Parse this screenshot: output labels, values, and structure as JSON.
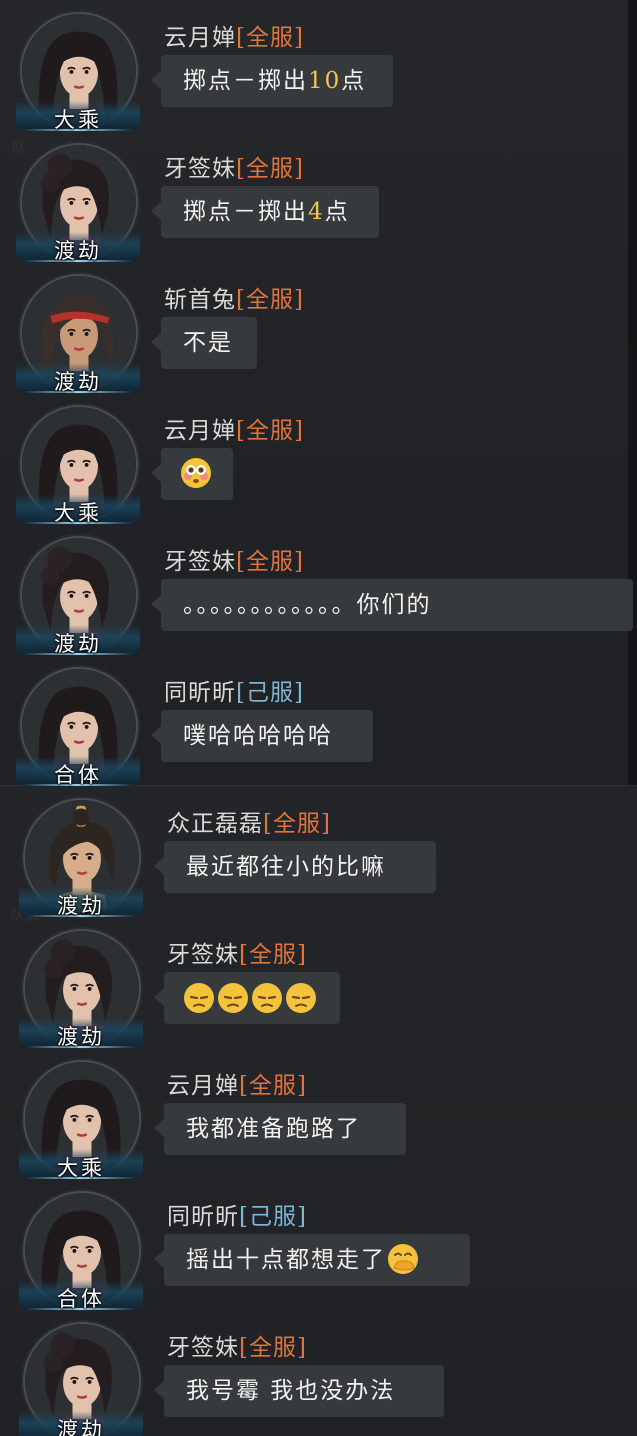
{
  "colors": {
    "background": "#1c1e20",
    "bubble": "#373a3c",
    "tag_server": "#e0743c",
    "tag_own_server": "#7fb4d6",
    "highlight_number": "#f2c94c",
    "text": "#f2f2f0",
    "name": "#d9d9d6"
  },
  "background_text": [
    "队",
    "队伍"
  ],
  "messages": [
    {
      "avatar": "female-dark-hair-avatar",
      "rank": "大乘",
      "name": "云月婵",
      "tag": "[全服]",
      "text_prefix": "掷点－掷出",
      "text_number": "10",
      "text_suffix": "点"
    },
    {
      "avatar": "female-bun-hair-avatar",
      "rank": "渡劫",
      "name": "牙签妹",
      "tag": "[全服]",
      "text_prefix": "掷点－掷出",
      "text_number": "4",
      "text_suffix": "点"
    },
    {
      "avatar": "male-headband-avatar",
      "rank": "渡劫",
      "name": "斩首兔",
      "tag": "[全服]",
      "text": "不是"
    },
    {
      "avatar": "female-dark-hair-avatar",
      "rank": "大乘",
      "name": "云月婵",
      "tag": "[全服]",
      "emojis": [
        "flushed-face-emoji"
      ]
    },
    {
      "avatar": "female-bun-hair-avatar",
      "rank": "渡劫",
      "name": "牙签妹",
      "tag": "[全服]",
      "text": "。。。。。。。。。。。。你们的"
    },
    {
      "avatar": "female-dark-hair-avatar",
      "rank": "合体",
      "name": "同昕昕",
      "tag": "[己服]",
      "text": "噗哈哈哈哈哈"
    },
    {
      "avatar": "female-topknot-avatar",
      "rank": "渡劫",
      "name": "众正磊磊",
      "tag": "[全服]",
      "text": "最近都往小的比嘛"
    },
    {
      "avatar": "female-bun-hair-avatar",
      "rank": "渡劫",
      "name": "牙签妹",
      "tag": "[全服]",
      "emojis": [
        "sweat-face-emoji",
        "sweat-face-emoji",
        "sweat-face-emoji",
        "sweat-face-emoji"
      ]
    },
    {
      "avatar": "female-dark-hair-avatar",
      "rank": "大乘",
      "name": "云月婵",
      "tag": "[全服]",
      "text": "我都准备跑路了"
    },
    {
      "avatar": "female-dark-hair-avatar",
      "rank": "合体",
      "name": "同昕昕",
      "tag": "[己服]",
      "text": "摇出十点都想走了",
      "emojis_after": [
        "hand-over-mouth-emoji"
      ]
    },
    {
      "avatar": "female-bun-hair-avatar",
      "rank": "渡劫",
      "name": "牙签妹",
      "tag": "[全服]",
      "text": "我号霉 我也没办法"
    }
  ]
}
